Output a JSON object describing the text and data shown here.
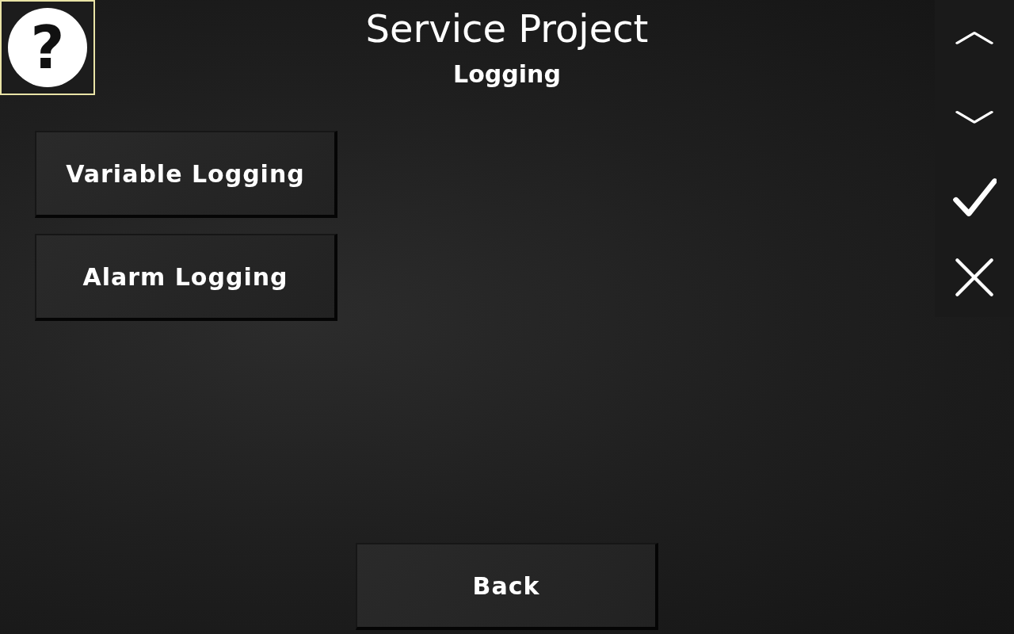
{
  "help_button": {
    "label": "?"
  },
  "title": "Service Project",
  "subtitle": "Logging",
  "menu_buttons": [
    {
      "label": "Variable Logging"
    },
    {
      "label": "Alarm Logging"
    }
  ],
  "back_button": {
    "label": "Back"
  },
  "side_toolbar": [
    {
      "kind": "up"
    },
    {
      "kind": "down"
    },
    {
      "kind": "confirm"
    },
    {
      "kind": "cancel"
    }
  ]
}
